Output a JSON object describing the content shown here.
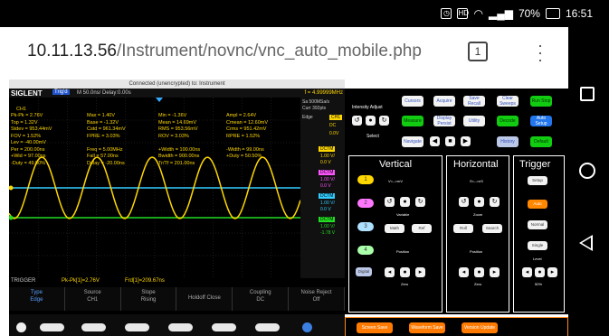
{
  "status_bar": {
    "battery": "70%",
    "time": "16:51"
  },
  "browser": {
    "url_host": "10.11.13.56",
    "url_path": "/Instrument/novnc/vnc_auto_mobile.php",
    "tab_count": "1"
  },
  "vnc": {
    "connection": "Connected (unencrypted) to: Instrument"
  },
  "scope": {
    "brand": "SIGLENT",
    "state": "Trig'd",
    "timebase": "M 50.0ns/  Delay:0.00s",
    "frequency": "f = 4.99999MHz",
    "meas_ch": "CH1",
    "meas": {
      "c1": [
        "Pk-Pk = 2.76V",
        "Top = 1.32V",
        "Stdev = 953.44mV",
        "FOV = 1.52%",
        "Lev = -40.00mV",
        "Per = 200.00ns",
        "+Wid = 97.00ns",
        "-Duty = 49.50%"
      ],
      "c2": [
        "Max = 1.40V",
        "Base = -1.32V",
        "Cstd = 961.34mV",
        "FPRE = 3.03%",
        "",
        "Freq = 5.00MHz",
        "Fall = 57.00ns",
        "Delay = -20.00ns"
      ],
      "c3": [
        "Min = -1.36V",
        "Mean = 14.69mV",
        "RMS = 953.56mV",
        "ROV = 3.03%",
        "",
        "+Width = 100.00ns",
        "Bwidth = 900.00ns",
        "Tr/Tf = 201.00ns"
      ],
      "c4": [
        "Ampl = 2.64V",
        "Cmean = 12.60mV",
        "Crms = 951.42mV",
        "RPRE = 1.52%",
        "",
        "-Width = 99.00ns",
        "+Duty = 50.50%",
        ""
      ]
    },
    "side": {
      "sample": "Sa 500MSa/s",
      "points": "Curr 392pts",
      "edge": "Edge",
      "edge_ch": "CH1",
      "coupling": "DC",
      "level": "0.0V",
      "ch1": [
        "DCTM",
        "1.00 V/",
        "0.0 V"
      ],
      "ch2": [
        "DCTM",
        "1.00 V/",
        "0.0 V"
      ],
      "ch3": [
        "DCTM",
        "1.00 V/",
        "0.0 V"
      ],
      "ch4": [
        "DCTM",
        "1.00 V/",
        "-1.78 V"
      ]
    },
    "trigger_line": "TRIGGER",
    "trig_meas": [
      "Pk-Pk[1]=2.76V",
      "Frd[1]=209.67ns"
    ],
    "softkeys": [
      {
        "t": "Type",
        "v": "Edge"
      },
      {
        "t": "Source",
        "v": "CH1"
      },
      {
        "t": "Slope",
        "v": "Rising"
      },
      {
        "t": "Holdoff Close",
        "v": ""
      },
      {
        "t": "Coupling",
        "v": "DC"
      },
      {
        "t": "Noise Reject",
        "v": "Off"
      }
    ],
    "colors": {
      "ch1": "#ffd700",
      "ch2": "#ff55ff",
      "ch3": "#33ccff",
      "ch4": "#22dd22"
    }
  },
  "panel": {
    "intensity": "Intensity Adjust",
    "select": "Select",
    "top_buttons": [
      "Cursors",
      "Acquire",
      "Save Recall",
      "Clear Sweeps",
      "Run Stop"
    ],
    "row2": [
      "Measure",
      "Display Persist",
      "Utility",
      "Decode",
      "Auto Setup"
    ],
    "row3": [
      "Navigate",
      "History",
      "Default"
    ],
    "vertical": {
      "title": "Vertical",
      "variable": "Variable",
      "position": "Position",
      "zero": "Zero",
      "pos_left": "V<-->mV",
      "math": "Math",
      "ref": "Ref",
      "digital": "Digital",
      "channels": [
        "1",
        "2",
        "3",
        "4"
      ]
    },
    "horizontal": {
      "title": "Horizontal",
      "zoom": "Zoom",
      "position": "Position",
      "zero": "Zero",
      "pos_left": "S<-->nS",
      "roll": "Roll",
      "search": "Search"
    },
    "trigger": {
      "title": "Trigger",
      "setup": "Setup",
      "auto": "Auto",
      "normal": "Normal",
      "single": "Single",
      "level": "Level",
      "fifty": "50%"
    },
    "bottom": [
      "Screen Save",
      "Waveform Save",
      "Version Update"
    ]
  }
}
